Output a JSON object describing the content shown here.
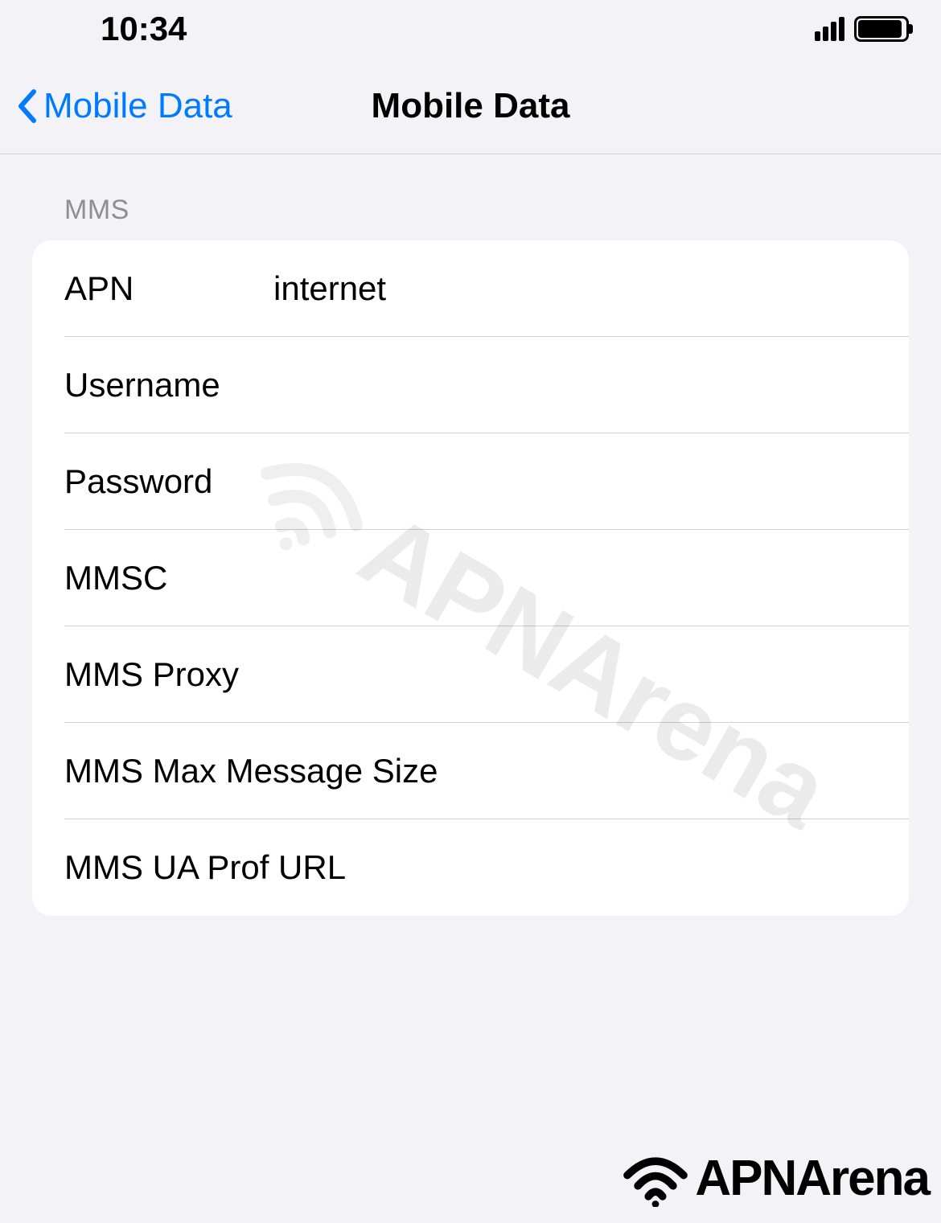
{
  "status_bar": {
    "time": "10:34"
  },
  "nav": {
    "back_label": "Mobile Data",
    "title": "Mobile Data"
  },
  "section": {
    "header": "MMS",
    "rows": [
      {
        "label": "APN",
        "value": "internet"
      },
      {
        "label": "Username",
        "value": ""
      },
      {
        "label": "Password",
        "value": ""
      },
      {
        "label": "MMSC",
        "value": ""
      },
      {
        "label": "MMS Proxy",
        "value": ""
      },
      {
        "label": "MMS Max Message Size",
        "value": ""
      },
      {
        "label": "MMS UA Prof URL",
        "value": ""
      }
    ]
  },
  "watermark": {
    "text": "APNArena"
  },
  "footer": {
    "logo_text": "APNArena"
  }
}
